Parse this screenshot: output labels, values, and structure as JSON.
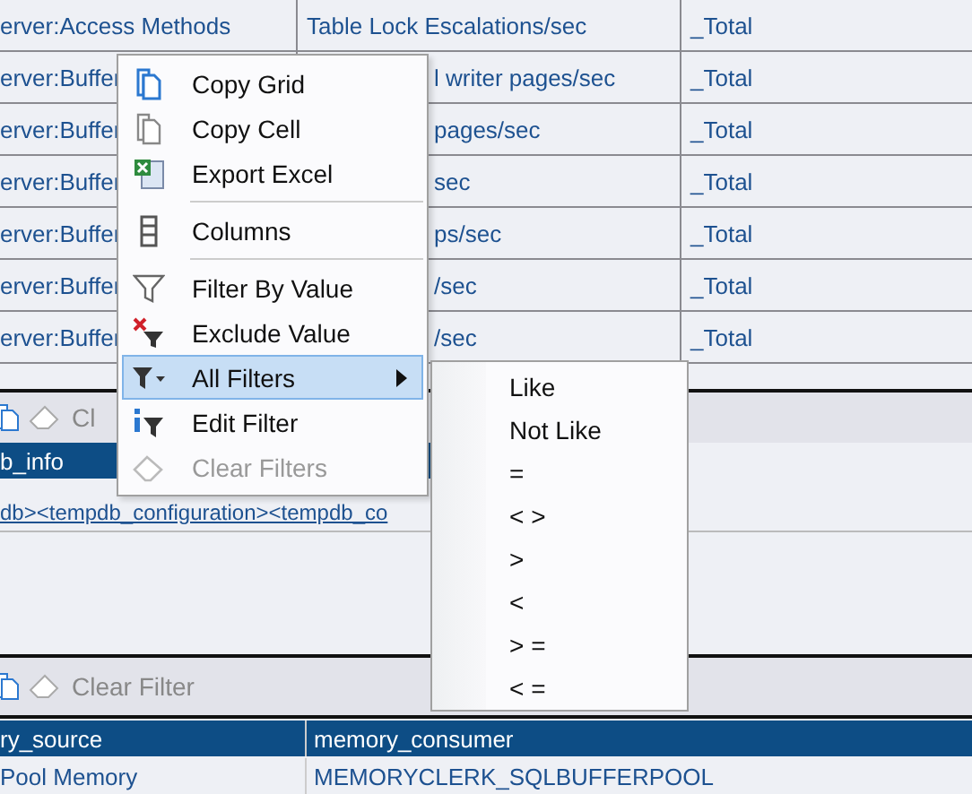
{
  "top_grid": {
    "rows": [
      {
        "covered": false,
        "cells": [
          "erver:Access Methods",
          "Table Lock Escalations/sec",
          "_Total"
        ]
      },
      {
        "covered": true,
        "cells": [
          "erver:Buffer",
          "l writer pages/sec",
          "_Total"
        ]
      },
      {
        "covered": true,
        "cells": [
          "erver:Buffer",
          "pages/sec",
          "_Total"
        ]
      },
      {
        "covered": true,
        "cells": [
          "erver:Buffer",
          "sec",
          "_Total"
        ]
      },
      {
        "covered": true,
        "cells": [
          "erver:Buffer",
          "ps/sec",
          "_Total"
        ]
      },
      {
        "covered": true,
        "cells": [
          "erver:Buffer",
          "/sec",
          "_Total"
        ]
      },
      {
        "covered": true,
        "cells": [
          "erver:Buffer",
          "/sec",
          "_Total"
        ]
      }
    ]
  },
  "middle_pane": {
    "toolbar_label": "Cl",
    "column": "b_info",
    "link": "db><tempdb_configuration><tempdb_co"
  },
  "bottom_pane": {
    "toolbar_label": "Clear Filter",
    "columns": [
      "ry_source",
      "memory_consumer"
    ],
    "row": [
      "Pool Memory",
      "MEMORYCLERK_SQLBUFFERPOOL"
    ]
  },
  "context_menu": {
    "items": [
      {
        "kind": "copy",
        "label": "Copy Grid",
        "selected": false,
        "disabled": false,
        "submenu": false
      },
      {
        "kind": "copy-cell",
        "label": "Copy Cell",
        "selected": false,
        "disabled": false,
        "submenu": false
      },
      {
        "kind": "excel",
        "label": "Export Excel",
        "selected": false,
        "disabled": false,
        "submenu": false
      },
      {
        "kind": "separator"
      },
      {
        "kind": "columns",
        "label": "Columns",
        "selected": false,
        "disabled": false,
        "submenu": false
      },
      {
        "kind": "separator"
      },
      {
        "kind": "filter",
        "label": "Filter By Value",
        "selected": false,
        "disabled": false,
        "submenu": false
      },
      {
        "kind": "exclude",
        "label": "Exclude Value",
        "selected": false,
        "disabled": false,
        "submenu": false
      },
      {
        "kind": "all-filters",
        "label": "All Filters",
        "selected": true,
        "disabled": false,
        "submenu": true
      },
      {
        "kind": "edit-filter",
        "label": "Edit Filter",
        "selected": false,
        "disabled": false,
        "submenu": false
      },
      {
        "kind": "eraser",
        "label": "Clear Filters",
        "selected": false,
        "disabled": true,
        "submenu": false
      }
    ]
  },
  "submenu": {
    "items": [
      "Like",
      "Not Like",
      "=",
      "< >",
      ">",
      "<",
      "> =",
      "< ="
    ]
  }
}
